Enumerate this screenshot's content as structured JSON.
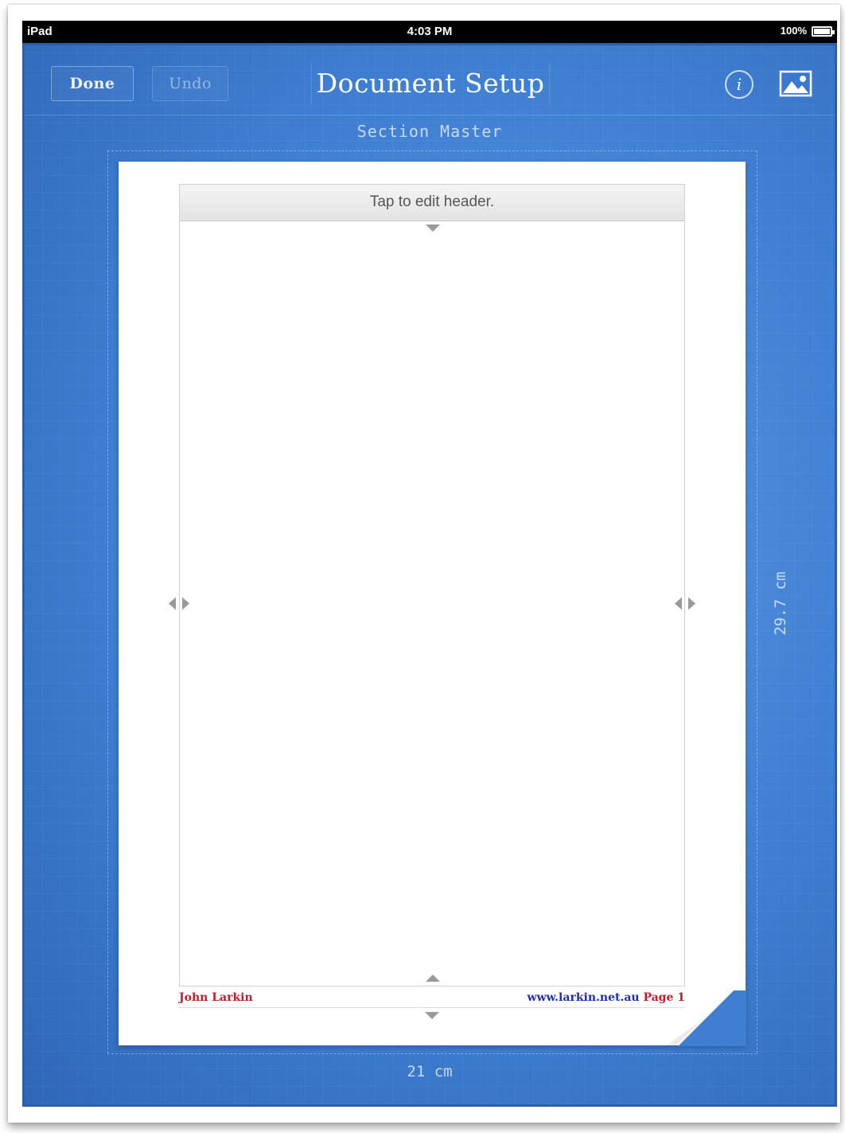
{
  "status_bar": {
    "carrier": "iPad",
    "time": "4:03 PM",
    "battery": "100%"
  },
  "toolbar": {
    "done_label": "Done",
    "undo_label": "Undo",
    "title": "Document Setup",
    "info_label": "i",
    "info_icon": "info-icon",
    "image_icon": "image-icon"
  },
  "subtitle": "Section Master",
  "page": {
    "header_placeholder": "Tap to edit header.",
    "footer_left": "John Larkin",
    "footer_url": "www.larkin.net.au",
    "footer_page": "Page 1"
  },
  "dimensions": {
    "width": "21 cm",
    "height": "29.7 cm"
  },
  "colors": {
    "blueprint": "#3f7fd2",
    "footer_red": "#c0202a",
    "footer_blue": "#1f2fb0"
  }
}
